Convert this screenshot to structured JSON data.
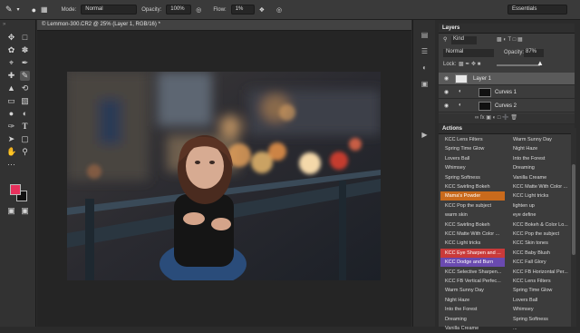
{
  "options_bar": {
    "mode_label": "Mode:",
    "mode_value": "Normal",
    "opacity_label": "Opacity:",
    "opacity_value": "100%",
    "flow_label": "Flow:",
    "flow_value": "1%",
    "workspace": "Essentials"
  },
  "document": {
    "tab_title": "© Lemmon-300.CR2 @ 25% (Layer 1, RGB/16) *"
  },
  "colors": {
    "foreground": "#e8305c",
    "background": "#111111"
  },
  "layers_panel": {
    "title": "Layers",
    "filter": "Kind",
    "blend_mode": "Normal",
    "opacity_label": "Opacity:",
    "opacity_value": "87%",
    "lock_label": "Lock:",
    "layers": [
      {
        "name": "Layer 1"
      },
      {
        "name": "Curves 1"
      },
      {
        "name": "Curves 2"
      }
    ]
  },
  "actions_panel": {
    "title": "Actions",
    "items": [
      {
        "left": "KCC Lens Filters",
        "right": "Warm Sunny Day"
      },
      {
        "left": "Spring Time Glow",
        "right": "Night Haze"
      },
      {
        "left": "Lovers Ball",
        "right": "Into the Forest"
      },
      {
        "left": "Whimsey",
        "right": "Dreaming"
      },
      {
        "left": "Spring Softness",
        "right": "Vanilla Creame"
      },
      {
        "left": "KCC Swirling Bokeh",
        "right": "KCC Matte With Color ..."
      },
      {
        "left": "Mama's Powder",
        "right": "KCC Light tricks",
        "left_color": "#c96a1c"
      },
      {
        "left": "KCC Pop the subject",
        "right": "lighten up"
      },
      {
        "left": "warm skin",
        "right": "eye define"
      },
      {
        "left": "KCC Swirling Bokeh",
        "right": "KCC Bokeh & Color Lo..."
      },
      {
        "left": "KCC Matte With Color ...",
        "right": "KCC Pop the subject"
      },
      {
        "left": "KCC Light tricks",
        "right": "KCC Skin tones"
      },
      {
        "left": "KCC Eye Sharpen and ...",
        "right": "KCC Baby Blush",
        "left_color": "#c93a3a"
      },
      {
        "left": "KCC Dodge and Burn",
        "right": "KCC Fall Glory",
        "left_color": "#6a4ab0"
      },
      {
        "left": "KCC Selective Sharpen...",
        "right": "KCC FB Horizontal Per..."
      },
      {
        "left": "KCC FB Vertical Perfec...",
        "right": "KCC Lens Filters"
      },
      {
        "left": "Warm Sunny Day",
        "right": "Spring Time Glow"
      },
      {
        "left": "Night Haze",
        "right": "Lovers Ball"
      },
      {
        "left": "Into the Forest",
        "right": "Whimsey"
      },
      {
        "left": "Dreaming",
        "right": "Spring Softness"
      },
      {
        "left": "Vanilla Creame",
        "right": "..."
      }
    ]
  },
  "icons": {
    "brush": "brush-icon",
    "eye": "eye-icon",
    "lock": "lock-icon"
  }
}
